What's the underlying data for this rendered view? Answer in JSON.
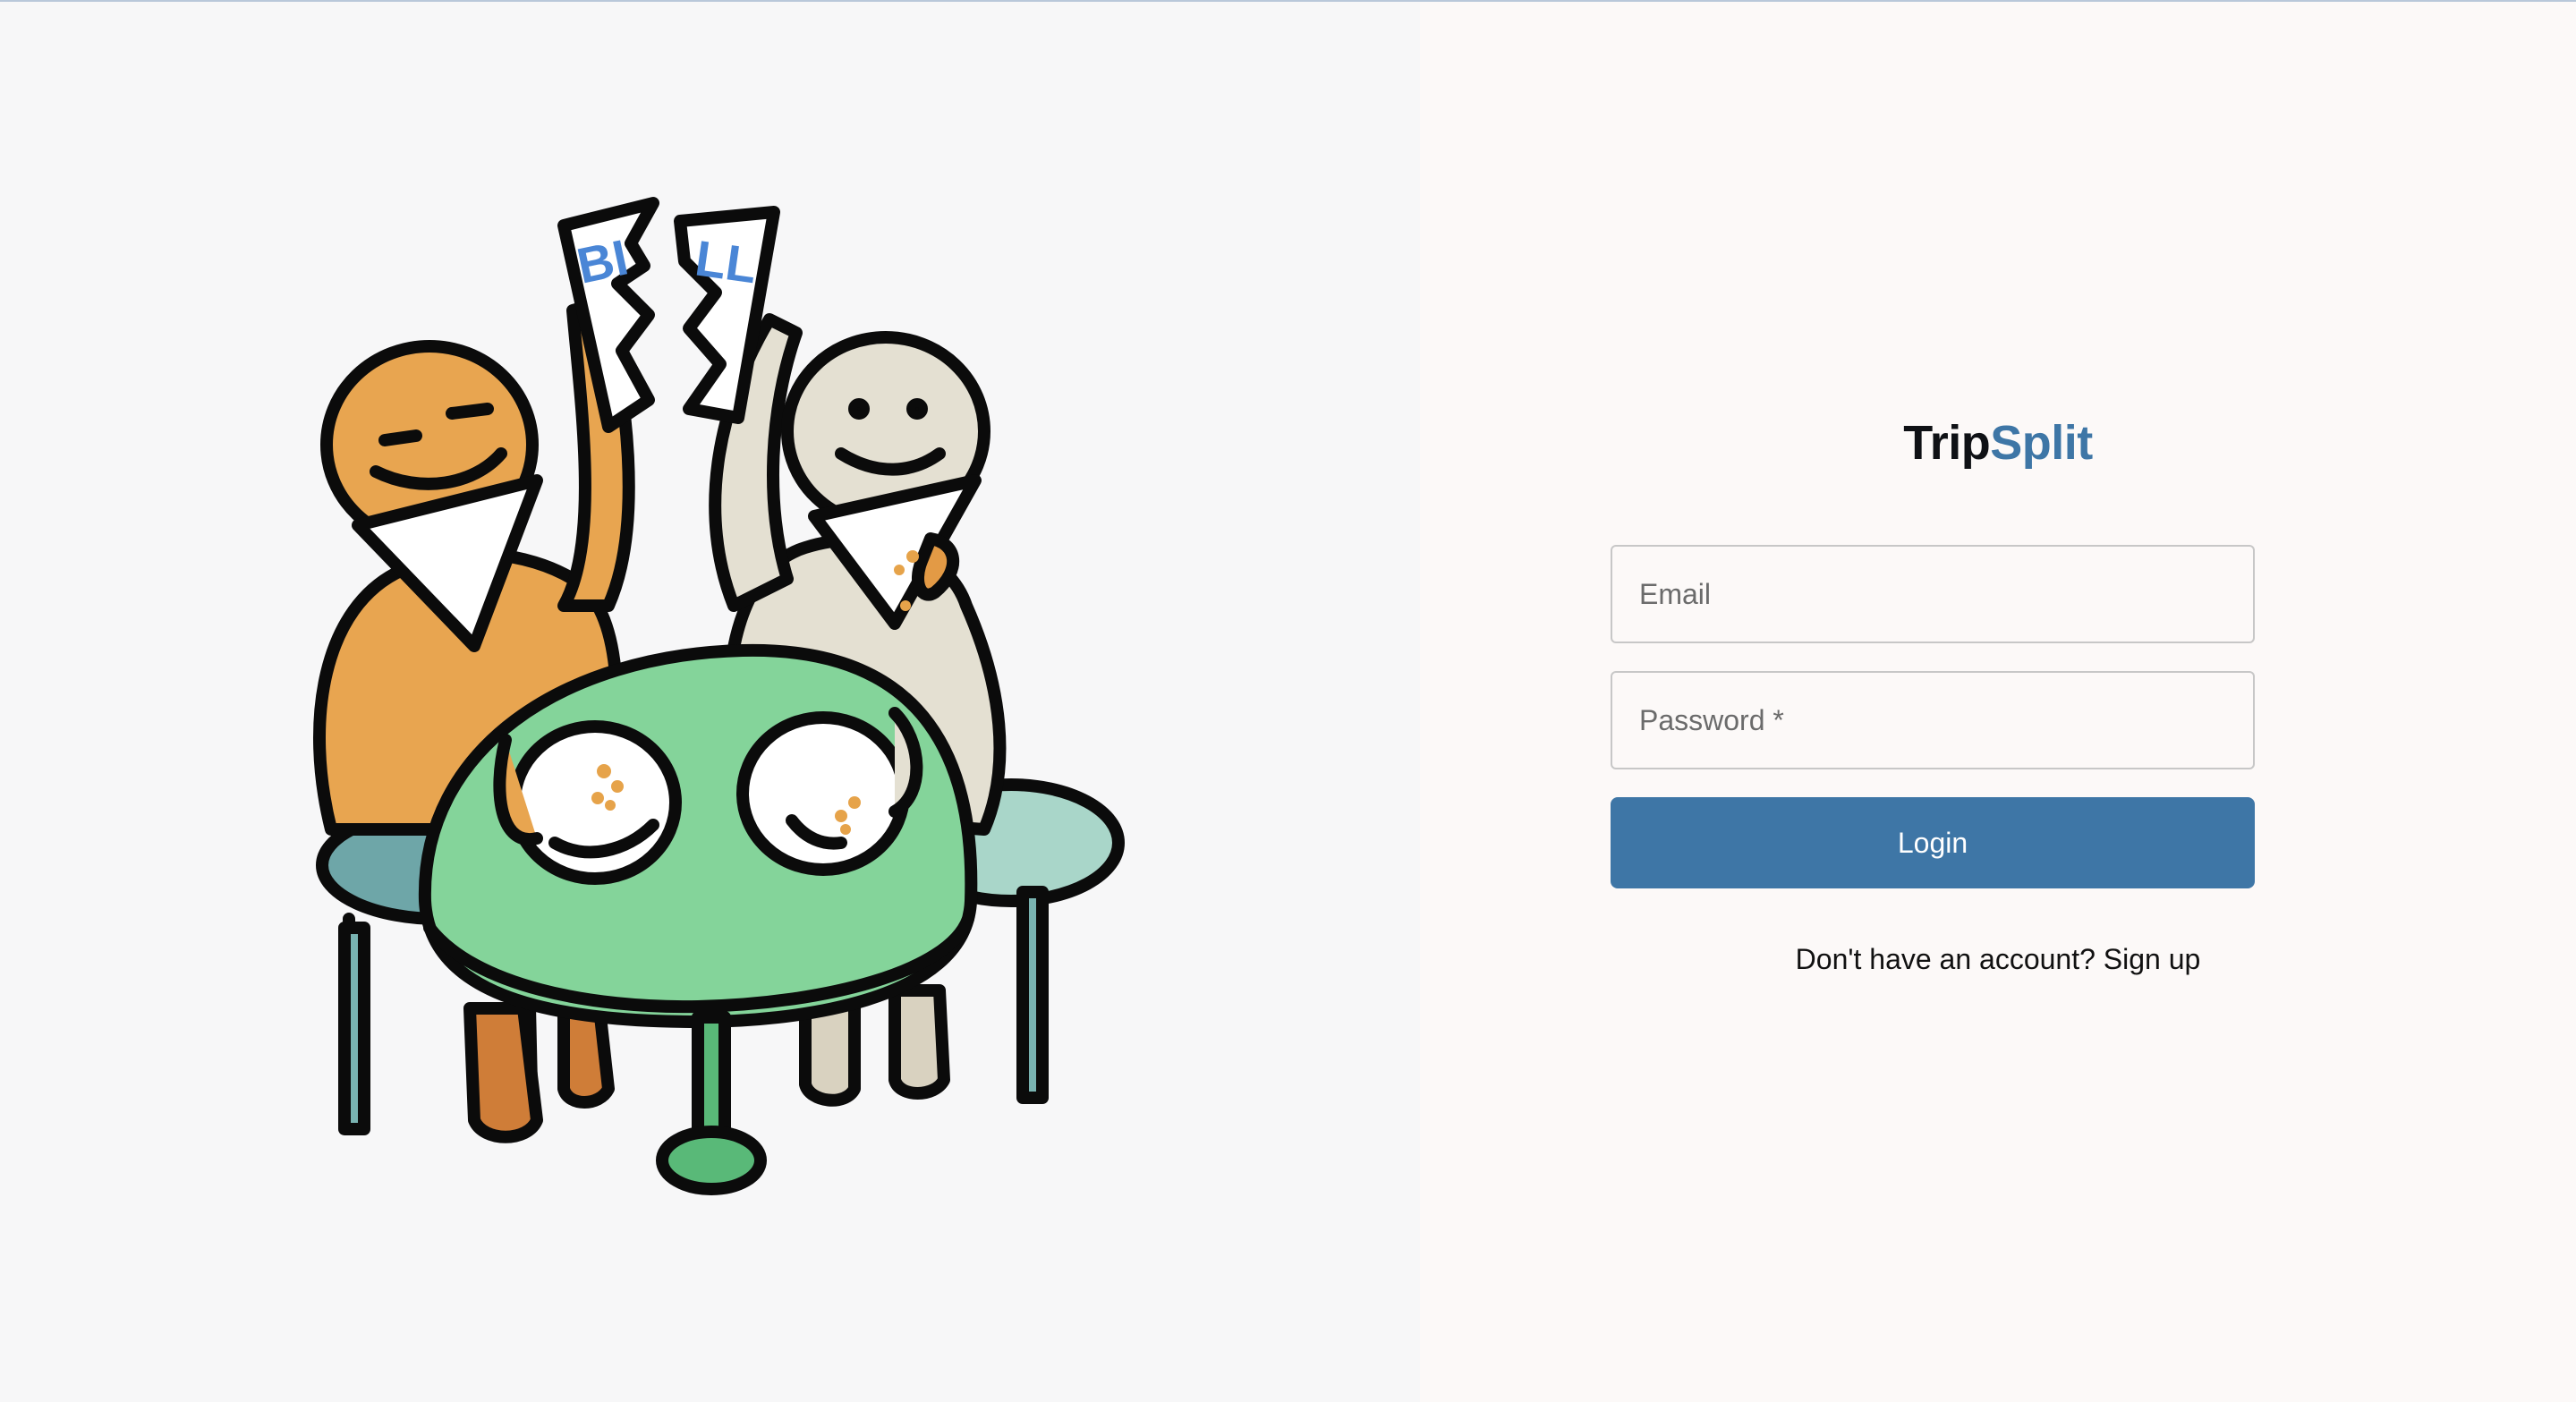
{
  "brand": {
    "part1": "Trip",
    "part2": "Split"
  },
  "form": {
    "email_placeholder": "Email",
    "password_placeholder": "Password *",
    "login_label": "Login"
  },
  "signup": {
    "prompt": "Don't have an account?",
    "link_label": "Sign up"
  },
  "illustration": {
    "bill_left_text": "BI",
    "bill_right_text": "LL"
  },
  "colors": {
    "accent": "#3e76a6",
    "left_bg": "#f7f7f8",
    "right_bg": "#fcf9f8"
  }
}
